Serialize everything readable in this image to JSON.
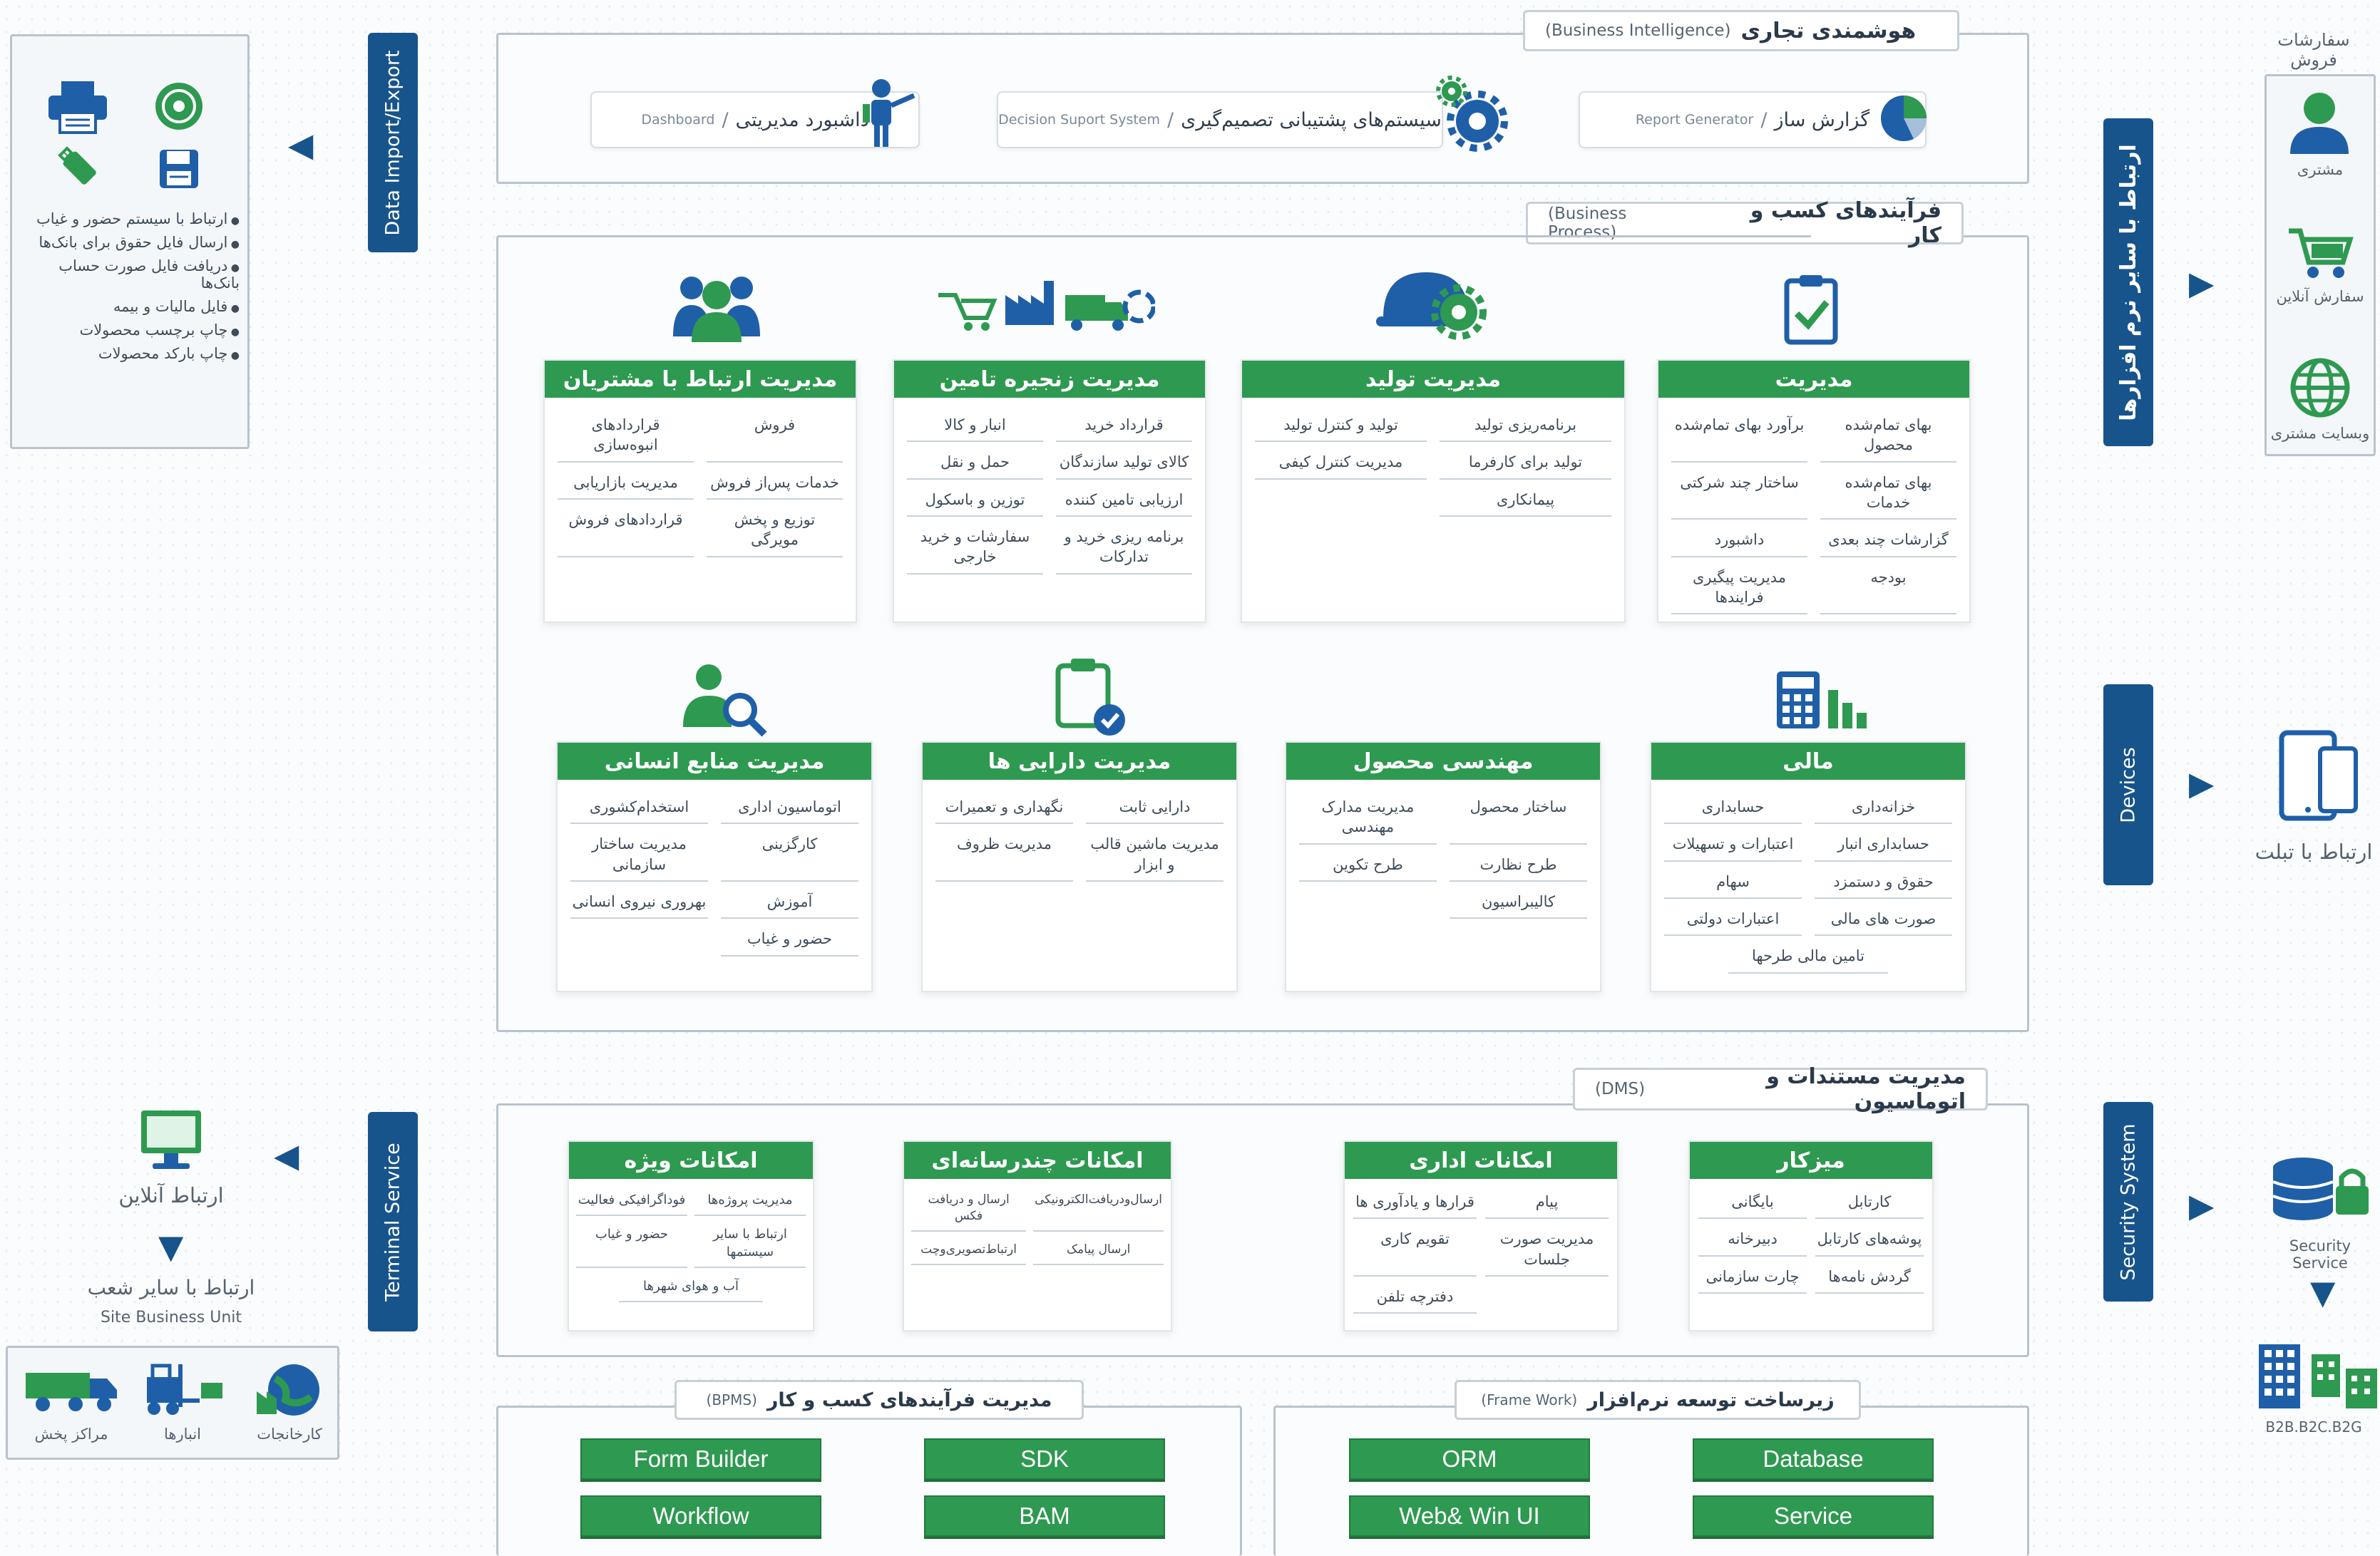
{
  "bi": {
    "title": "هوشمندی تجاری",
    "title_en": "(Business Intelligence)",
    "items": [
      {
        "fa": "داشبورد مدیریتی",
        "en": "Dashboard",
        "icon": "presenter-icon"
      },
      {
        "fa": "سیستم‌های پشتیبانی تصمیم‌گیری",
        "en": "Decision Suport System",
        "icon": "gears-icon"
      },
      {
        "fa": "گزارش ساز",
        "en": "Report Generator",
        "icon": "pie-chart-icon"
      }
    ]
  },
  "bp": {
    "title": "فرآیندهای کسب و کار",
    "title_en": "(Business Process)"
  },
  "modules": [
    {
      "title": "مدیریت ارتباط با مشتریان",
      "cells": [
        "فروش",
        "قراردادهای انبوه‌سازی",
        "خدمات پس‌از فروش",
        "مدیریت بازاریابی",
        "توزیع و پخش مویرگی",
        "قراردادهای فروش"
      ]
    },
    {
      "title": "مدیریت زنجیره تامین",
      "cells": [
        "قرارداد خرید",
        "انبار و کالا",
        "کالای تولید سازندگان",
        "حمل و نقل",
        "ارزیابی تامین کننده",
        "توزین و باسکول",
        "برنامه ریزی خرید و تدارکات",
        "سفارشات و خرید خارجی"
      ]
    },
    {
      "title": "مدیریت تولید",
      "cells": [
        "برنامه‌ریزی تولید",
        "تولید و کنترل تولید",
        "تولید برای کارفرما",
        "مدیریت کنترل کیفی",
        "پیمانکاری",
        ""
      ]
    },
    {
      "title": "مدیریت",
      "cells": [
        "بهای تمام‌شده محصول",
        "برآورد بهای تمام‌شده",
        "بهای تمام‌شده خدمات",
        "ساختار چند شرکتی",
        "گزارشات چند بعدی",
        "داشبورد",
        "بودجه",
        "مدیریت پیگیری فرایندها"
      ]
    },
    {
      "title": "مدیریت منابع انسانی",
      "cells": [
        "اتوماسیون اداری",
        "استخدام‌کشوری",
        "کارگزینی",
        "مدیریت ساختار سازمانی",
        "آموزش",
        "بهروری نیروی انسانی",
        "حضور و غیاب",
        ""
      ]
    },
    {
      "title": "مدیریت دارایی ها",
      "cells": [
        "دارایی ثابت",
        "نگهداری و تعمیرات",
        "مدیریت ماشین قالب و ابزار",
        "مدیریت ظروف"
      ]
    },
    {
      "title": "مهندسی محصول",
      "cells": [
        "ساختار محصول",
        "مدیریت مدارک مهندسی",
        "طرح نظارت",
        "طرح تکوین",
        "کالیبراسیون",
        ""
      ]
    },
    {
      "title": "مالی",
      "cells": [
        "خزانه‌داری",
        "حسابداری",
        "حسابداری انبار",
        "اعتبارات و تسهیلات",
        "حقوق و دستمزد",
        "سهام",
        "صورت های مالی",
        "اعتبارات دولتی"
      ],
      "full": "تامین مالی طرحها"
    }
  ],
  "dms": {
    "title": "مدیریت مستندات و اتوماسیون",
    "title_en": "(DMS)",
    "cards": [
      {
        "title": "امکانات ویژه",
        "cells": [
          "مدیریت پروژه‌ها",
          "فوداگرافیکی فعالیت",
          "ارتباط با سایر سیستمها",
          "حضور و غیاب"
        ],
        "full": "آب و هوای شهرها"
      },
      {
        "title": "امکانات چندرسانه‌ای",
        "cells": [
          "ارسال‌ودریافت‌الکترونیکی",
          "ارسال و دریافت فکس",
          "ارسال پیامک",
          "ارتباط‌تصویری‌وچت"
        ]
      },
      {
        "title": "امکانات اداری",
        "cells": [
          "پیام",
          "قرارها و یادآوری ها",
          "مدیریت صورت جلسات",
          "تقویم کاری",
          "",
          "دفترچه تلفن"
        ]
      },
      {
        "title": "میزکار",
        "cells": [
          "کارتابل",
          "بایگانی",
          "پوشه‌های کارتابل",
          "دبیرخانه",
          "گردش نامه‌ها",
          "چارت سازمانی"
        ]
      }
    ]
  },
  "bpms": {
    "title": "مدیریت فرآیندهای کسب و کار",
    "title_en": "(BPMS)",
    "buttons": [
      "Form Builder",
      "SDK",
      "Workflow",
      "BAM"
    ]
  },
  "framework": {
    "title": "زیرساخت توسعه نرم‌افزار",
    "title_en": "(Frame Work)",
    "buttons": [
      "ORM",
      "Database",
      "Web& Win UI",
      "Service"
    ]
  },
  "left": {
    "data_ie": "Data Import/Export",
    "list": [
      "ارتباط با سیستم حضور و غیاب",
      "ارسال فایل حقوق برای بانک‌ها",
      "دریافت فایل صورت حساب بانک‌ها",
      "فایل مالیات و بیمه",
      "چاپ برچسب محصولات",
      "چاپ بارکد محصولات"
    ],
    "terminal": "Terminal Service",
    "online": "ارتباط آنلاین",
    "branches": "ارتباط با سایر شعب",
    "branches_en": "Site Business Unit",
    "sites": [
      "کارخانجات",
      "انبارها",
      "مراکز پخش"
    ]
  },
  "right": {
    "orders_title": "سفارشات فروش",
    "orders": [
      "مشتری",
      "سفارش آنلاین",
      "وبسایت مشتری"
    ],
    "other_sw": "ارتباط با سایر نرم افزارها",
    "devices": "Devices",
    "tablet": "ارتباط با تبلت",
    "security_system": "Security System",
    "security_service": "Security Service",
    "b2b": "B2B.B2C.B2G"
  },
  "colors": {
    "green": "#2e9950",
    "navy": "#17548c",
    "blue_icon": "#1f5fa8"
  }
}
